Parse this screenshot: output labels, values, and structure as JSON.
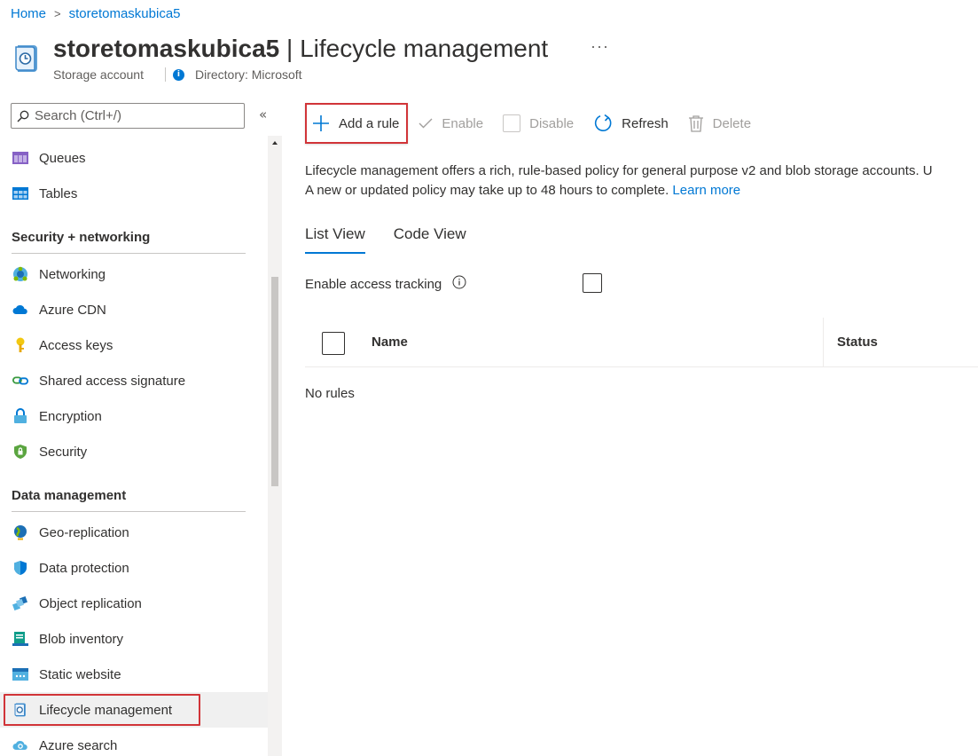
{
  "breadcrumb": {
    "home": "Home",
    "separator": ">",
    "current": "storetomaskubica5"
  },
  "header": {
    "resource": "storetomaskubica5",
    "separator": " | ",
    "page": "Lifecycle management",
    "more": "···",
    "type": "Storage account",
    "directory": "Directory: Microsoft"
  },
  "search": {
    "placeholder": "Search (Ctrl+/)",
    "collapse": "«"
  },
  "sidebar": {
    "items_top": [
      {
        "label": "Queues",
        "icon": "queues-icon"
      },
      {
        "label": "Tables",
        "icon": "tables-icon"
      }
    ],
    "section_security": "Security + networking",
    "security_items": [
      {
        "label": "Networking",
        "icon": "networking-icon"
      },
      {
        "label": "Azure CDN",
        "icon": "cloud-icon"
      },
      {
        "label": "Access keys",
        "icon": "key-icon"
      },
      {
        "label": "Shared access signature",
        "icon": "link-icon"
      },
      {
        "label": "Encryption",
        "icon": "lock-icon"
      },
      {
        "label": "Security",
        "icon": "shield-icon"
      }
    ],
    "section_data": "Data management",
    "data_items": [
      {
        "label": "Geo-replication",
        "icon": "globe-icon"
      },
      {
        "label": "Data protection",
        "icon": "shield-check-icon"
      },
      {
        "label": "Object replication",
        "icon": "cubes-icon"
      },
      {
        "label": "Blob inventory",
        "icon": "inventory-icon"
      },
      {
        "label": "Static website",
        "icon": "website-icon"
      },
      {
        "label": "Lifecycle management",
        "icon": "lifecycle-icon",
        "selected": true
      },
      {
        "label": "Azure search",
        "icon": "search-cloud-icon"
      }
    ]
  },
  "toolbar": {
    "add_rule": "Add a rule",
    "enable": "Enable",
    "disable": "Disable",
    "refresh": "Refresh",
    "delete": "Delete"
  },
  "description": {
    "line1": "Lifecycle management offers a rich, rule-based policy for general purpose v2 and blob storage accounts. U",
    "line2": "A new or updated policy may take up to 48 hours to complete.",
    "learn_more": "Learn more"
  },
  "tabs": [
    {
      "label": "List View",
      "active": true
    },
    {
      "label": "Code View",
      "active": false
    }
  ],
  "tracking": {
    "label": "Enable access tracking",
    "checked": false
  },
  "grid": {
    "col_name": "Name",
    "col_status": "Status",
    "empty": "No rules"
  },
  "colors": {
    "accent": "#0078d4",
    "highlight": "#d13438",
    "text": "#323130",
    "disabled": "#a19f9d"
  }
}
